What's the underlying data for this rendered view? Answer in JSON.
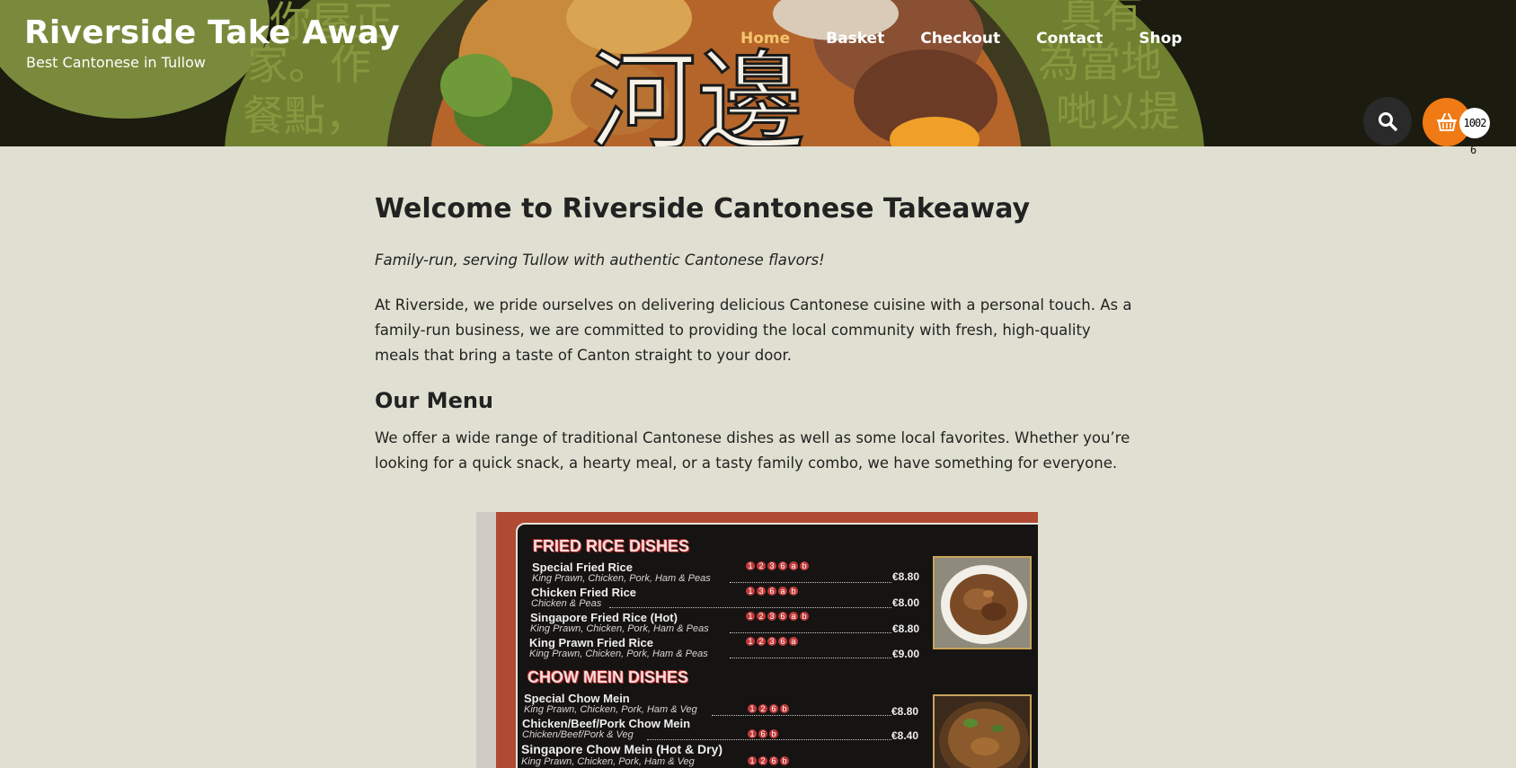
{
  "header": {
    "site_title": "Riverside Take Away",
    "tagline": "Best Cantonese in Tullow",
    "background_lettering": "河邊",
    "background_text": [
      "你屋正",
      "家。作",
      "餐點，",
      "真有",
      "為當地",
      "哋以提"
    ],
    "brand_colors": {
      "header_bg": "#1b1b0f",
      "olive": "#7a8a3c",
      "nav_active": "#f5c56d",
      "basket_orange": "#f07a13"
    }
  },
  "nav": {
    "items": [
      {
        "label": "Home",
        "active": true
      },
      {
        "label": "Basket",
        "active": false
      },
      {
        "label": "Checkout",
        "active": false
      },
      {
        "label": "Contact",
        "active": false
      },
      {
        "label": "Shop",
        "active": false
      }
    ]
  },
  "actions": {
    "search_icon": "search-icon",
    "basket_icon": "basket-icon",
    "basket_count": "1002",
    "basket_count_overflow": "6"
  },
  "main": {
    "title": "Welcome to Riverside Cantonese Takeaway",
    "subtitle": "Family-run, serving Tullow with authentic Cantonese flavors!",
    "intro": "At Riverside, we pride ourselves on delivering delicious Cantonese cuisine with a personal touch. As a family-run business, we are committed to providing the local community with fresh, high-quality meals that bring a taste of Canton straight to your door.",
    "menu_heading": "Our Menu",
    "menu_intro": "We offer a wide range of traditional Cantonese dishes as well as some local favorites. Whether you’re looking for a quick snack, a hearty meal, or a tasty family combo, we have something for everyone."
  },
  "menu_image": {
    "sections": [
      {
        "heading": "FRIED RICE DISHES",
        "items": [
          {
            "name": "Special Fried Rice",
            "desc": "King Prawn, Chicken, Pork, Ham & Peas",
            "codes": [
              "1",
              "2",
              "3",
              "6",
              "a",
              "b"
            ],
            "price": "€8.80"
          },
          {
            "name": "Chicken Fried Rice",
            "desc": "Chicken & Peas",
            "codes": [
              "1",
              "3",
              "6",
              "a",
              "b"
            ],
            "price": "€8.00"
          },
          {
            "name": "Singapore Fried Rice (Hot)",
            "desc": "King Prawn, Chicken, Pork, Ham & Peas",
            "codes": [
              "1",
              "2",
              "3",
              "6",
              "a",
              "b"
            ],
            "price": "€8.80"
          },
          {
            "name": "King Prawn Fried Rice",
            "desc": "King Prawn, Chicken, Pork, Ham & Peas",
            "codes": [
              "1",
              "2",
              "3",
              "6",
              "a"
            ],
            "price": "€9.00"
          }
        ]
      },
      {
        "heading": "CHOW MEIN DISHES",
        "items": [
          {
            "name": "Special Chow Mein",
            "desc": "King Prawn, Chicken, Pork, Ham & Veg",
            "codes": [
              "1",
              "2",
              "6",
              "b"
            ],
            "price": "€8.80"
          },
          {
            "name": "Chicken/Beef/Pork Chow Mein",
            "desc": "Chicken/Beef/Pork & Veg",
            "codes": [
              "1",
              "6",
              "b"
            ],
            "price": "€8.40"
          },
          {
            "name": "Singapore Chow Mein (Hot & Dry)",
            "desc": "King Prawn, Chicken, Pork, Ham & Veg",
            "codes": [
              "1",
              "2",
              "6",
              "b"
            ],
            "price": ""
          }
        ]
      }
    ]
  }
}
